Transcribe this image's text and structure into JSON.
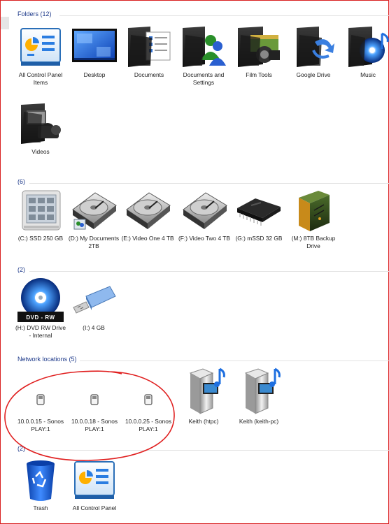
{
  "groups": {
    "folders": {
      "header": "Folders (12)",
      "items": [
        "All Control Panel Items",
        "Desktop",
        "Documents",
        "Documents and Settings",
        "Film Tools",
        "Google Drive",
        "Music",
        "Videos"
      ]
    },
    "drives": {
      "header": "(6)",
      "items": [
        "(C:) SSD 250 GB",
        "(D:) My Documents 2TB",
        "(E:) Video One 4 TB",
        "(F:) Video Two 4 TB",
        "(G:) mSSD 32 GB",
        "(M:) 8TB Backup Drive"
      ]
    },
    "removable": {
      "header": "(2)",
      "items": [
        "(H:) DVD RW Drive - Internal",
        "(I:) 4 GB"
      ],
      "dvd_badge": "DVD - RW"
    },
    "network": {
      "header": "Network locations (5)",
      "items": [
        "10.0.0.15 - Sonos PLAY:1",
        "10.0.0.18 - Sonos PLAY:1",
        "10.0.0.25 - Sonos PLAY:1",
        "Keith (htpc)",
        "Keith (keith-pc)"
      ]
    },
    "other": {
      "header": "(2)",
      "items": [
        "Trash",
        "All Control Panel"
      ]
    }
  },
  "colors": {
    "group_header": "#1e3a8a",
    "annotation_circle": "#e02020",
    "selection_frame": "#d92020"
  }
}
